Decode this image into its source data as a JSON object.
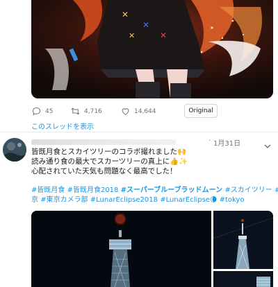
{
  "previous_tweet": {
    "reply_count": "45",
    "retweet_count": "4,716",
    "like_count": "14,644",
    "original_button": "Original",
    "thread_link": "このスレッドを表示"
  },
  "tweet": {
    "dot": "·",
    "date": "1月31日",
    "text_lines": [
      "皆既月食とスカイツリーのコラボ撮れました🙌",
      "読み通り食の最大でスカーツリーの真上に👍✨",
      "心配されていた天気も問題なく最高でした！"
    ],
    "hashtags_line1": [
      "#皆既月食",
      "#皆既月食2018",
      "#スーパーブルーブラッドムーン",
      "#スカイツリー",
      "#東"
    ],
    "hashtags_line2": [
      "京",
      "#東京カメラ部",
      "#LunarEclipse2018",
      "#LunarEclipse🌘",
      "#tokyo"
    ]
  },
  "colors": {
    "link": "#1b95e0",
    "muted": "#657786",
    "divider": "#e6ecf0"
  },
  "icons": [
    "reply-icon",
    "retweet-icon",
    "like-icon",
    "chevron-down-icon"
  ]
}
